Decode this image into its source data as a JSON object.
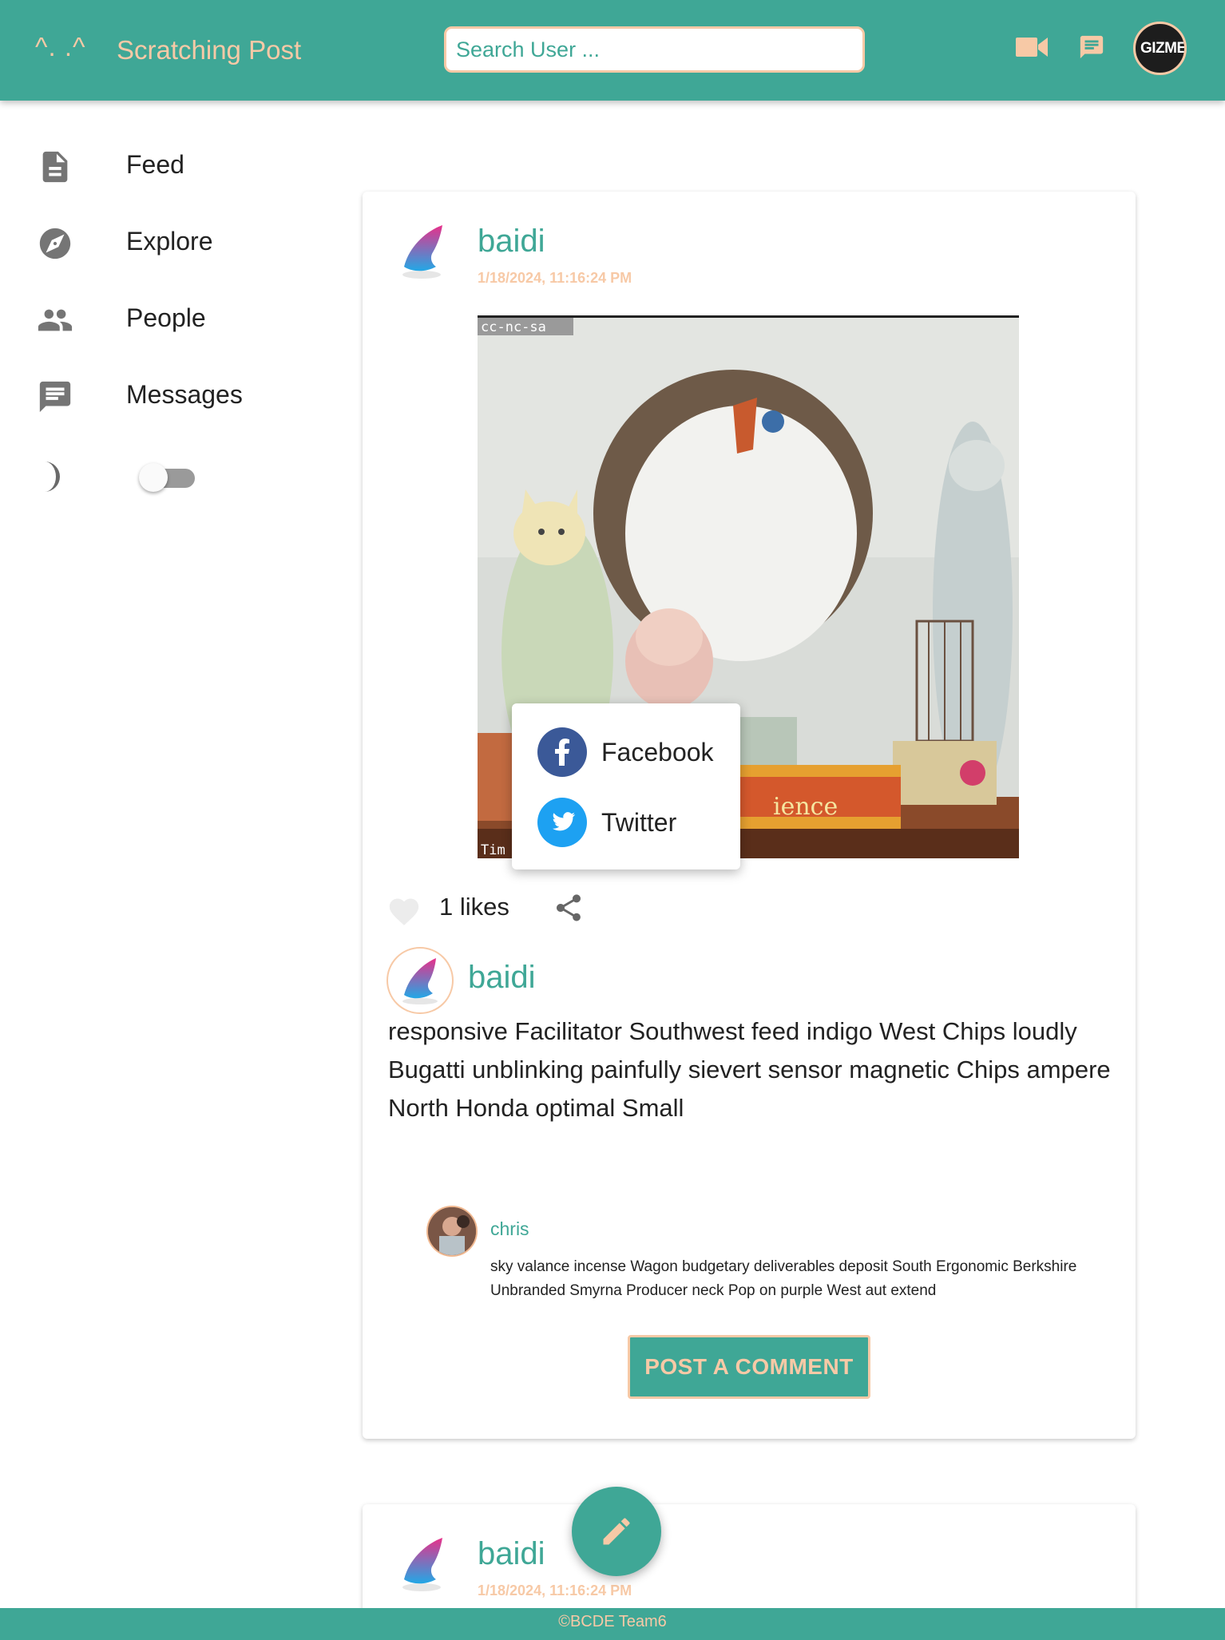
{
  "header": {
    "logo_glyph": "^. .^",
    "app_name": "Scratching Post",
    "search_placeholder": "Search User ...",
    "avatar_text": "GIZMEI"
  },
  "sidebar": {
    "items": [
      {
        "label": "Feed",
        "icon": "document-icon"
      },
      {
        "label": "Explore",
        "icon": "compass-icon"
      },
      {
        "label": "People",
        "icon": "people-icon"
      },
      {
        "label": "Messages",
        "icon": "message-icon"
      }
    ],
    "dark_mode": {
      "icon": "moon-icon",
      "enabled": false
    }
  },
  "posts": [
    {
      "username": "baidi",
      "timestamp": "1/18/2024, 11:16:24 PM",
      "image_overlay_text": "cc-nc-sa",
      "image_bottom_text": "Tim",
      "image_banner_text": "ience",
      "likes_text": "1 likes",
      "share_menu": [
        {
          "label": "Facebook",
          "icon": "facebook-icon",
          "color": "#3b5998"
        },
        {
          "label": "Twitter",
          "icon": "twitter-icon",
          "color": "#1da1f2"
        }
      ],
      "caption_user": "baidi",
      "caption": "responsive Facilitator Southwest feed indigo West Chips loudly Bugatti unblinking painfully sievert sensor magnetic Chips ampere North Honda optimal Small",
      "comments": [
        {
          "user": "chris",
          "text": "sky valance incense Wagon budgetary deliverables deposit South Ergonomic Berkshire Unbranded Smyrna Producer neck Pop on purple West aut extend"
        }
      ],
      "post_comment_label": "POST A COMMENT"
    },
    {
      "username": "baidi",
      "timestamp": "1/18/2024, 11:16:24 PM"
    }
  ],
  "footer": {
    "text": "©BCDE Team6"
  },
  "colors": {
    "primary": "#3fa796",
    "accent": "#f7c9a6"
  }
}
